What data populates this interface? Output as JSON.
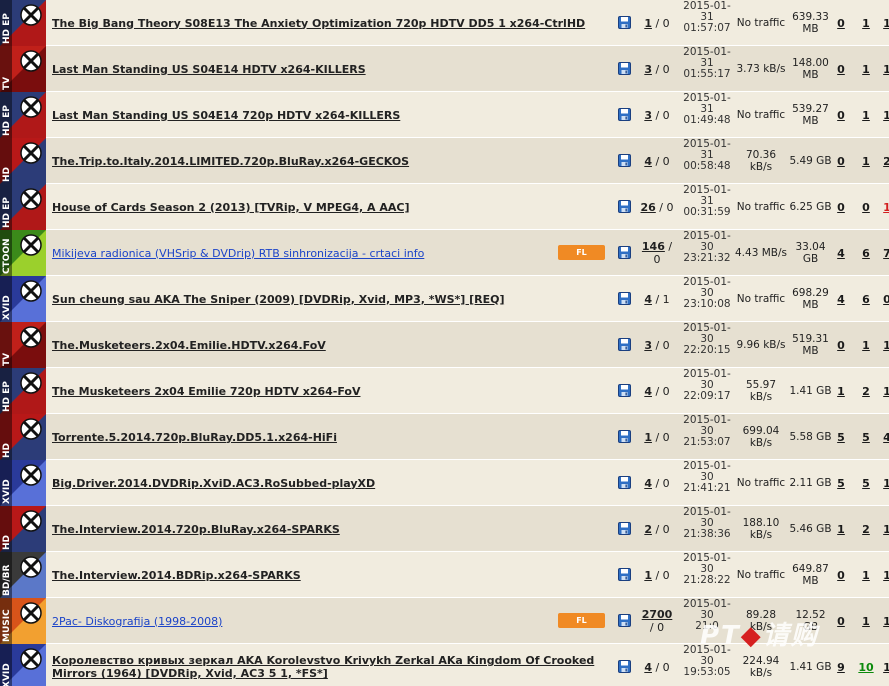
{
  "watermark": {
    "text": "PT",
    "mark": "◆",
    "text2": "请购"
  },
  "rows": [
    {
      "cat": "HD EP",
      "icon": "hd-ep-category-icon",
      "c1": "#2c3c78",
      "c2": "#b01818",
      "name": "The Big Bang Theory S08E13 The Anxiety Optimization 720p HDTV DD5 1 x264-CtrlHD",
      "blue": false,
      "fl": false,
      "files": "1",
      "comments": "0",
      "date1": "2015-01-",
      "date2": "31",
      "date3": "01:57:07",
      "traffic": "No traffic",
      "size": "639.33 MB",
      "seeders": "0",
      "leechers": "1",
      "snatched": "1"
    },
    {
      "cat": "TV",
      "icon": "tv-category-icon",
      "c1": "#c0201a",
      "c2": "#7a0d0d",
      "name": "Last Man Standing US S04E14 HDTV x264-KILLERS",
      "blue": false,
      "fl": false,
      "files": "3",
      "comments": "0",
      "date1": "2015-01-",
      "date2": "31",
      "date3": "01:55:17",
      "traffic": "3.73 kB/s",
      "size": "148.00 MB",
      "seeders": "0",
      "leechers": "1",
      "snatched": "1"
    },
    {
      "cat": "HD EP",
      "icon": "hd-ep-category-icon",
      "c1": "#2c3c78",
      "c2": "#b01818",
      "name": "Last Man Standing US S04E14 720p HDTV x264-KILLERS",
      "blue": false,
      "fl": false,
      "files": "3",
      "comments": "0",
      "date1": "2015-01-",
      "date2": "31",
      "date3": "01:49:48",
      "traffic": "No traffic",
      "size": "539.27 MB",
      "seeders": "0",
      "leechers": "1",
      "snatched": "1"
    },
    {
      "cat": "HD",
      "icon": "hd-category-icon",
      "c1": "#b81818",
      "c2": "#2c3c78",
      "name": "The.Trip.to.Italy.2014.LIMITED.720p.BluRay.x264-GECKOS",
      "blue": false,
      "fl": false,
      "files": "4",
      "comments": "0",
      "date1": "2015-01-",
      "date2": "31",
      "date3": "00:58:48",
      "traffic": "70.36 kB/s",
      "size": "5.49 GB",
      "seeders": "0",
      "leechers": "1",
      "snatched": "2"
    },
    {
      "cat": "HD EP",
      "icon": "hd-ep-category-icon",
      "c1": "#2c3c78",
      "c2": "#b01818",
      "name": "House of Cards Season 2 (2013) [TVRip, V MPEG4, A AAC]",
      "blue": false,
      "fl": false,
      "files": "26",
      "comments": "0",
      "date1": "2015-01-",
      "date2": "31",
      "date3": "00:31:59",
      "traffic": "No traffic",
      "size": "6.25 GB",
      "seeders": "0",
      "leechers": "0",
      "snatched": "1",
      "snatchedRed": true
    },
    {
      "cat": "CTOON",
      "icon": "cartoon-category-icon",
      "c1": "#3b8a1a",
      "c2": "#9bd02c",
      "name": "Mikijeva radionica (VHSrip & DVDrip) RTB sinhronizacija - crtaci info",
      "blue": true,
      "fl": true,
      "fl_label": "FL",
      "files": "146",
      "comments": "0",
      "date1": "2015-01-",
      "date2": "30",
      "date3": "23:21:32",
      "traffic": "4.43 MB/s",
      "size": "33.04 GB",
      "seeders": "4",
      "leechers": "6",
      "snatched": "7"
    },
    {
      "cat": "XVID",
      "icon": "xvid-category-icon",
      "c1": "#2a3a9a",
      "c2": "#5870d8",
      "name": "Sun cheung sau AKA The Sniper (2009) [DVDRip, Xvid, MP3, *WS*] [REQ]",
      "blue": false,
      "fl": false,
      "files": "4",
      "comments": "1",
      "date1": "2015-01-",
      "date2": "30",
      "date3": "23:10:08",
      "traffic": "No traffic",
      "size": "698.29 MB",
      "seeders": "4",
      "leechers": "6",
      "snatched": "0"
    },
    {
      "cat": "TV",
      "icon": "tv-category-icon",
      "c1": "#c0201a",
      "c2": "#7a0d0d",
      "name": "The.Musketeers.2x04.Emilie.HDTV.x264.FoV",
      "blue": false,
      "fl": false,
      "files": "3",
      "comments": "0",
      "date1": "2015-01-",
      "date2": "30",
      "date3": "22:20:15",
      "traffic": "9.96 kB/s",
      "size": "519.31 MB",
      "seeders": "0",
      "leechers": "1",
      "snatched": "1"
    },
    {
      "cat": "HD EP",
      "icon": "hd-ep-category-icon",
      "c1": "#2c3c78",
      "c2": "#b01818",
      "name": "The Musketeers 2x04 Emilie 720p HDTV x264-FoV",
      "blue": false,
      "fl": false,
      "files": "4",
      "comments": "0",
      "date1": "2015-01-",
      "date2": "30",
      "date3": "22:09:17",
      "traffic": "55.97 kB/s",
      "size": "1.41 GB",
      "seeders": "1",
      "leechers": "2",
      "snatched": "1"
    },
    {
      "cat": "HD",
      "icon": "hd-category-icon",
      "c1": "#b81818",
      "c2": "#2c3c78",
      "name": "Torrente.5.2014.720p.BluRay.DD5.1.x264-HiFi",
      "blue": false,
      "fl": false,
      "files": "1",
      "comments": "0",
      "date1": "2015-01-",
      "date2": "30",
      "date3": "21:53:07",
      "traffic": "699.04 kB/s",
      "size": "5.58 GB",
      "seeders": "5",
      "leechers": "5",
      "snatched": "4"
    },
    {
      "cat": "XVID",
      "icon": "xvid-category-icon",
      "c1": "#2a3a9a",
      "c2": "#5870d8",
      "name": "Big.Driver.2014.DVDRip.XviD.AC3.RoSubbed-playXD",
      "blue": false,
      "fl": false,
      "files": "4",
      "comments": "0",
      "date1": "2015-01-",
      "date2": "30",
      "date3": "21:41:21",
      "traffic": "No traffic",
      "size": "2.11 GB",
      "seeders": "5",
      "leechers": "5",
      "snatched": "1"
    },
    {
      "cat": "HD",
      "icon": "hd-category-icon",
      "c1": "#b81818",
      "c2": "#2c3c78",
      "name": "The.Interview.2014.720p.BluRay.x264-SPARKS",
      "blue": false,
      "fl": false,
      "files": "2",
      "comments": "0",
      "date1": "2015-01-",
      "date2": "30",
      "date3": "21:38:36",
      "traffic": "188.10 kB/s",
      "size": "5.46 GB",
      "seeders": "1",
      "leechers": "2",
      "snatched": "1"
    },
    {
      "cat": "BD/BR",
      "icon": "bluray-category-icon",
      "c1": "#3a3a3a",
      "c2": "#5b78c8",
      "name": "The.Interview.2014.BDRip.x264-SPARKS",
      "blue": false,
      "fl": false,
      "files": "1",
      "comments": "0",
      "date1": "2015-01-",
      "date2": "30",
      "date3": "21:28:22",
      "traffic": "No traffic",
      "size": "649.87 MB",
      "seeders": "0",
      "leechers": "1",
      "snatched": "1"
    },
    {
      "cat": "MUSIC",
      "icon": "music-category-icon",
      "c1": "#d8541a",
      "c2": "#f2a030",
      "name": "2Pac- Diskografija (1998-2008)",
      "blue": true,
      "fl": true,
      "fl_label": "FL",
      "files": "2700",
      "comments": "0",
      "date1": "2015-01-",
      "date2": "30",
      "date3": "21:0",
      "traffic": "89.28 kB/s",
      "size": "12.52 GB",
      "seeders": "0",
      "leechers": "1",
      "snatched": "1"
    },
    {
      "cat": "XVID",
      "icon": "xvid-category-icon",
      "c1": "#2a3a9a",
      "c2": "#5870d8",
      "name": "Королевство кривых зеркал AKA Korolevstvo Krivykh Zerkal AKa Kingdom Of Crooked Mirrors (1964) [DVDRip, Xvid, AC3 5 1, *FS*]",
      "blue": false,
      "fl": false,
      "files": "4",
      "comments": "0",
      "date1": "2015-01-",
      "date2": "30",
      "date3": "19:53:05",
      "traffic": "224.94 kB/s",
      "size": "1.41 GB",
      "seeders": "9",
      "leechers": "10",
      "snatched": "1",
      "leechGreen": true
    }
  ]
}
